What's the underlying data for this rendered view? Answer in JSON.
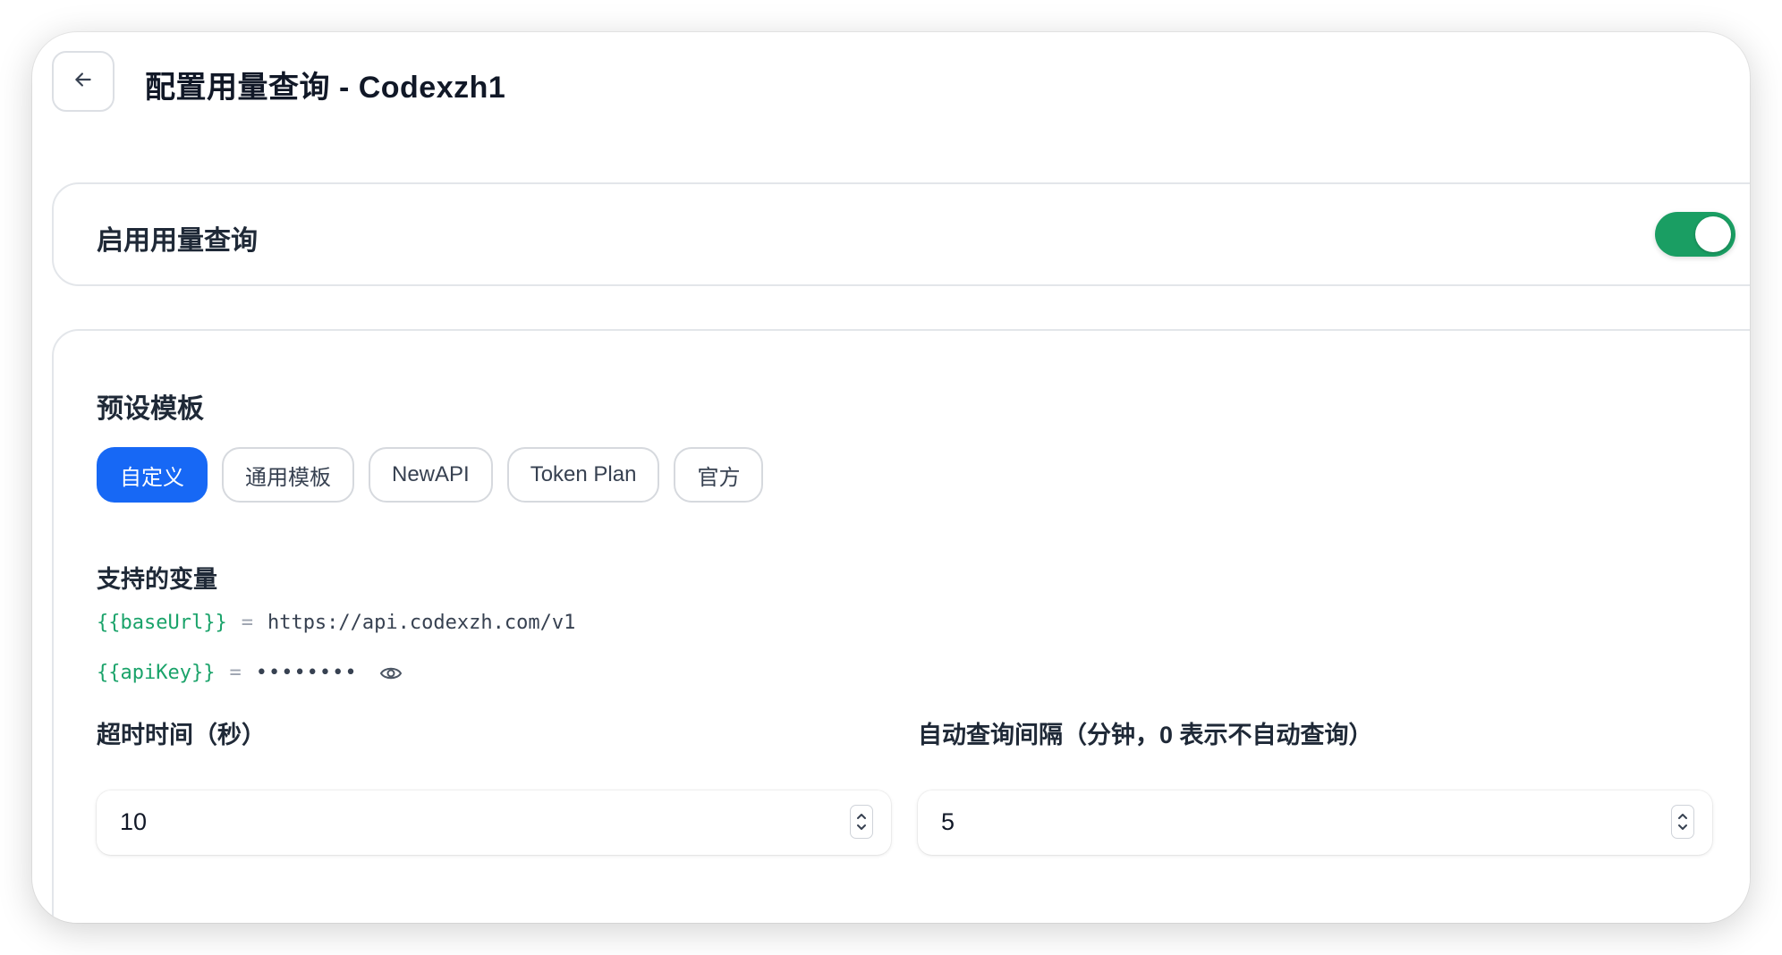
{
  "header": {
    "title": "配置用量查询 - Codexzh1",
    "back_icon": "arrow-left-icon"
  },
  "usage_toggle": {
    "label": "启用用量查询",
    "enabled": true,
    "accent": "#1a9e63"
  },
  "templates": {
    "title": "预设模板",
    "accent": "#1768f5",
    "items": [
      {
        "label": "自定义",
        "active": true
      },
      {
        "label": "通用模板",
        "active": false
      },
      {
        "label": "NewAPI",
        "active": false
      },
      {
        "label": "Token Plan",
        "active": false
      },
      {
        "label": "官方",
        "active": false
      }
    ]
  },
  "variables": {
    "title": "支持的变量",
    "items": [
      {
        "name": "{{baseUrl}}",
        "eq": "=",
        "value": "https://api.codexzh.com/v1"
      },
      {
        "name": "{{apiKey}}",
        "eq": "=",
        "value": "••••••••",
        "toggle_icon": "eye-icon"
      }
    ],
    "name_color": "#1aa36a"
  },
  "timeout": {
    "label": "超时时间（秒）",
    "value": "10"
  },
  "interval": {
    "label": "自动查询间隔（分钟，0 表示不自动查询）",
    "value": "5"
  }
}
